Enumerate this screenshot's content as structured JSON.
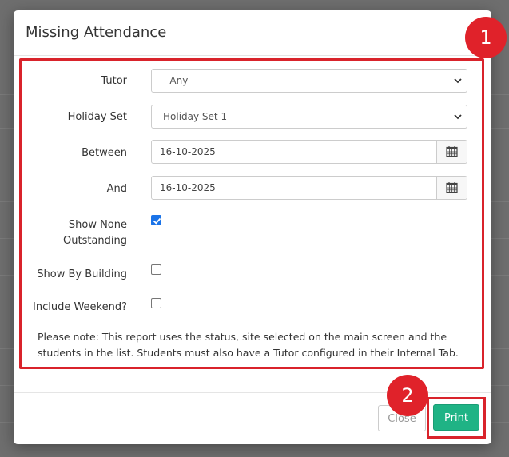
{
  "modal": {
    "title": "Missing Attendance",
    "fields": {
      "tutor": {
        "label": "Tutor",
        "value": "--Any--"
      },
      "holiday_set": {
        "label": "Holiday Set",
        "value": "Holiday Set 1"
      },
      "between": {
        "label": "Between",
        "value": "16-10-2025"
      },
      "and": {
        "label": "And",
        "value": "16-10-2025"
      },
      "show_none_outstanding": {
        "label_line1": "Show None",
        "label_line2": "Outstanding",
        "checked": true
      },
      "show_by_building": {
        "label": "Show By Building",
        "checked": false
      },
      "include_weekend": {
        "label": "Include Weekend?",
        "checked": false
      }
    },
    "note": "Please note: This report uses the status, site selected on the main screen and the students in the list. Students must also have a Tutor configured in their Internal Tab.",
    "footer": {
      "close_label": "Close",
      "print_label": "Print"
    }
  },
  "annotations": {
    "badge1": "1",
    "badge2": "2"
  },
  "colors": {
    "highlight": "#d9232b",
    "print_button": "#1fb385",
    "checkbox": "#1a73e8"
  }
}
